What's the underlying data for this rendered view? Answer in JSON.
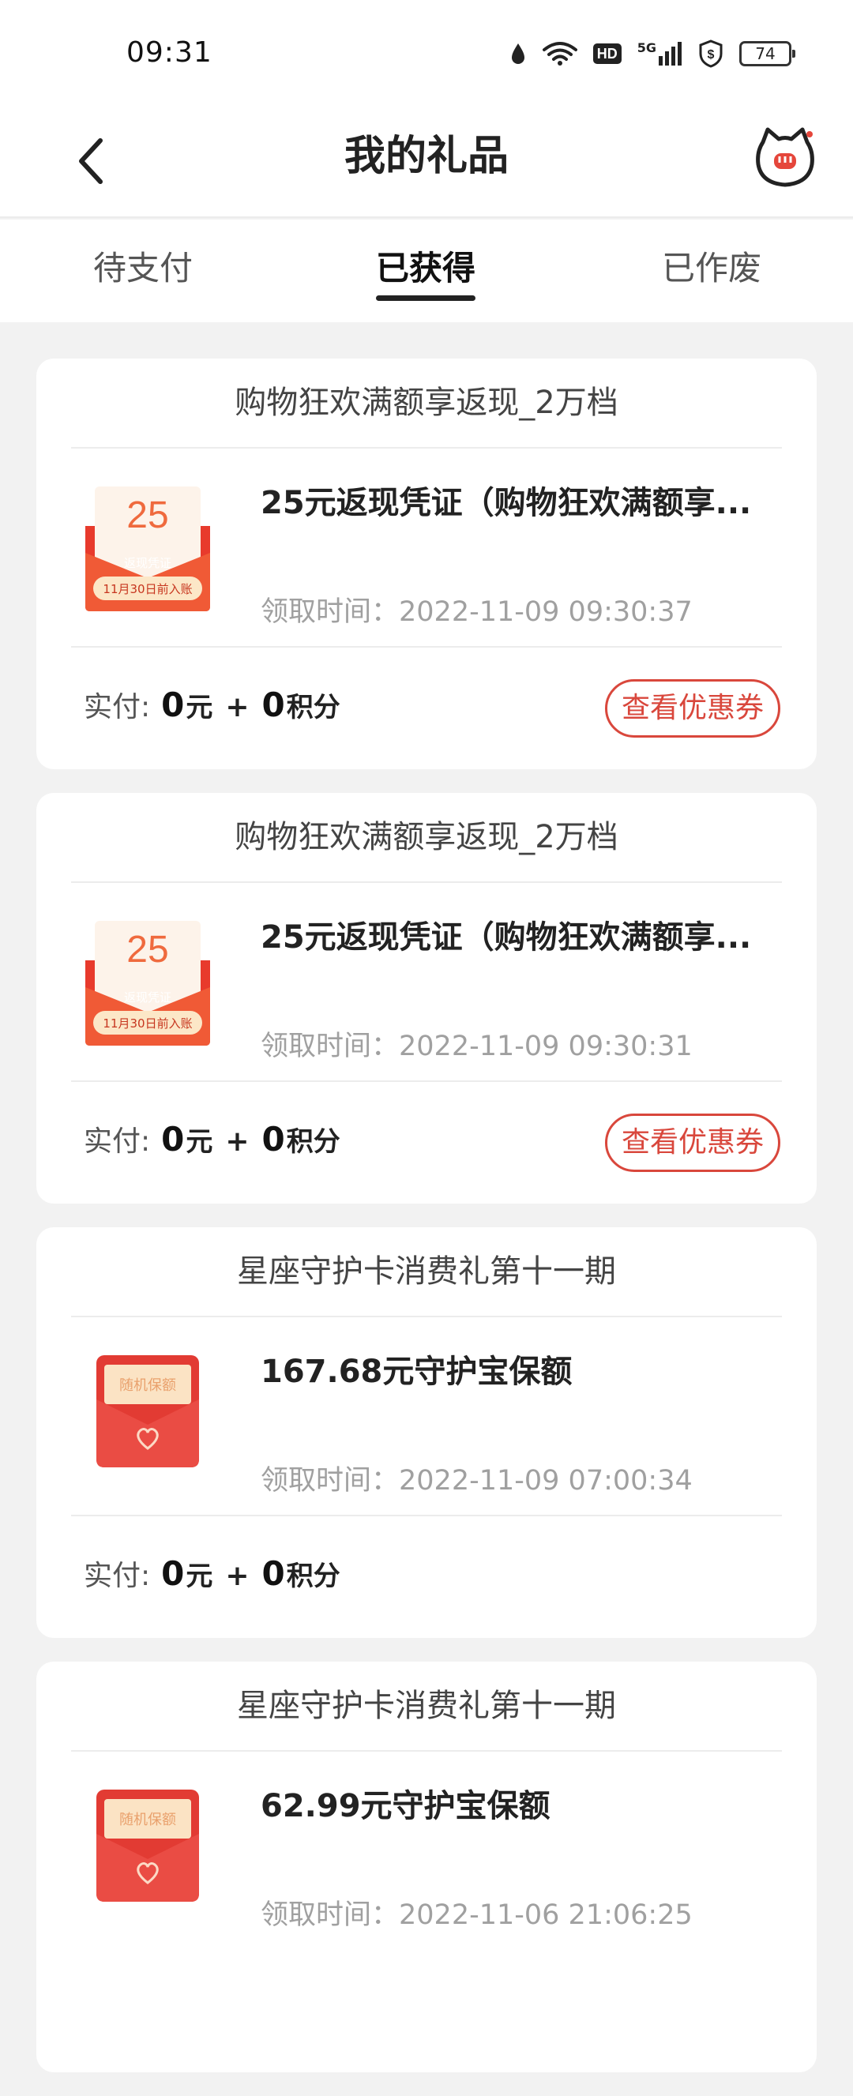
{
  "status_bar": {
    "time": "09:31",
    "icons": [
      "water-drop-icon",
      "wifi-icon",
      "hd-icon",
      "signal-5g-icon",
      "shield-icon",
      "battery-icon"
    ],
    "hd_label": "HD",
    "network_label": "5G",
    "battery": "74"
  },
  "header": {
    "title": "我的礼品",
    "back_icon": "chevron-left-icon",
    "right_icon": "cat-mascot-icon"
  },
  "tabs": [
    {
      "label": "待支付",
      "active": false
    },
    {
      "label": "已获得",
      "active": true
    },
    {
      "label": "已作废",
      "active": false
    }
  ],
  "colors": {
    "accent": "#d9473c",
    "background": "#f2f2f2",
    "card": "#ffffff"
  },
  "gifts": [
    {
      "title": "购物狂欢满额享返现_2万档",
      "name": "25元返现凭证（购物狂欢满额享...",
      "time_label": "领取时间：",
      "time": "2022-11-09 09:30:37",
      "thumb": {
        "type": "cashback",
        "amount": "25",
        "caption": "返现凭证",
        "note": "11月30日前入账"
      },
      "pay_label": "实付:",
      "cash": "0",
      "cash_unit": "元",
      "plus": "+",
      "points": "0",
      "points_unit": "积分",
      "action": "查看优惠券"
    },
    {
      "title": "购物狂欢满额享返现_2万档",
      "name": "25元返现凭证（购物狂欢满额享...",
      "time_label": "领取时间：",
      "time": "2022-11-09 09:30:31",
      "thumb": {
        "type": "cashback",
        "amount": "25",
        "caption": "返现凭证",
        "note": "11月30日前入账"
      },
      "pay_label": "实付:",
      "cash": "0",
      "cash_unit": "元",
      "plus": "+",
      "points": "0",
      "points_unit": "积分",
      "action": "查看优惠券"
    },
    {
      "title": "星座守护卡消费礼第十一期",
      "name": "167.68元守护宝保额",
      "time_label": "领取时间：",
      "time": "2022-11-09 07:00:34",
      "thumb": {
        "type": "insurance",
        "caption": "随机保额"
      },
      "pay_label": "实付:",
      "cash": "0",
      "cash_unit": "元",
      "plus": "+",
      "points": "0",
      "points_unit": "积分",
      "action": ""
    },
    {
      "title": "星座守护卡消费礼第十一期",
      "name": "62.99元守护宝保额",
      "time_label": "领取时间：",
      "time": "2022-11-06 21:06:25",
      "thumb": {
        "type": "insurance",
        "caption": "随机保额"
      }
    }
  ]
}
